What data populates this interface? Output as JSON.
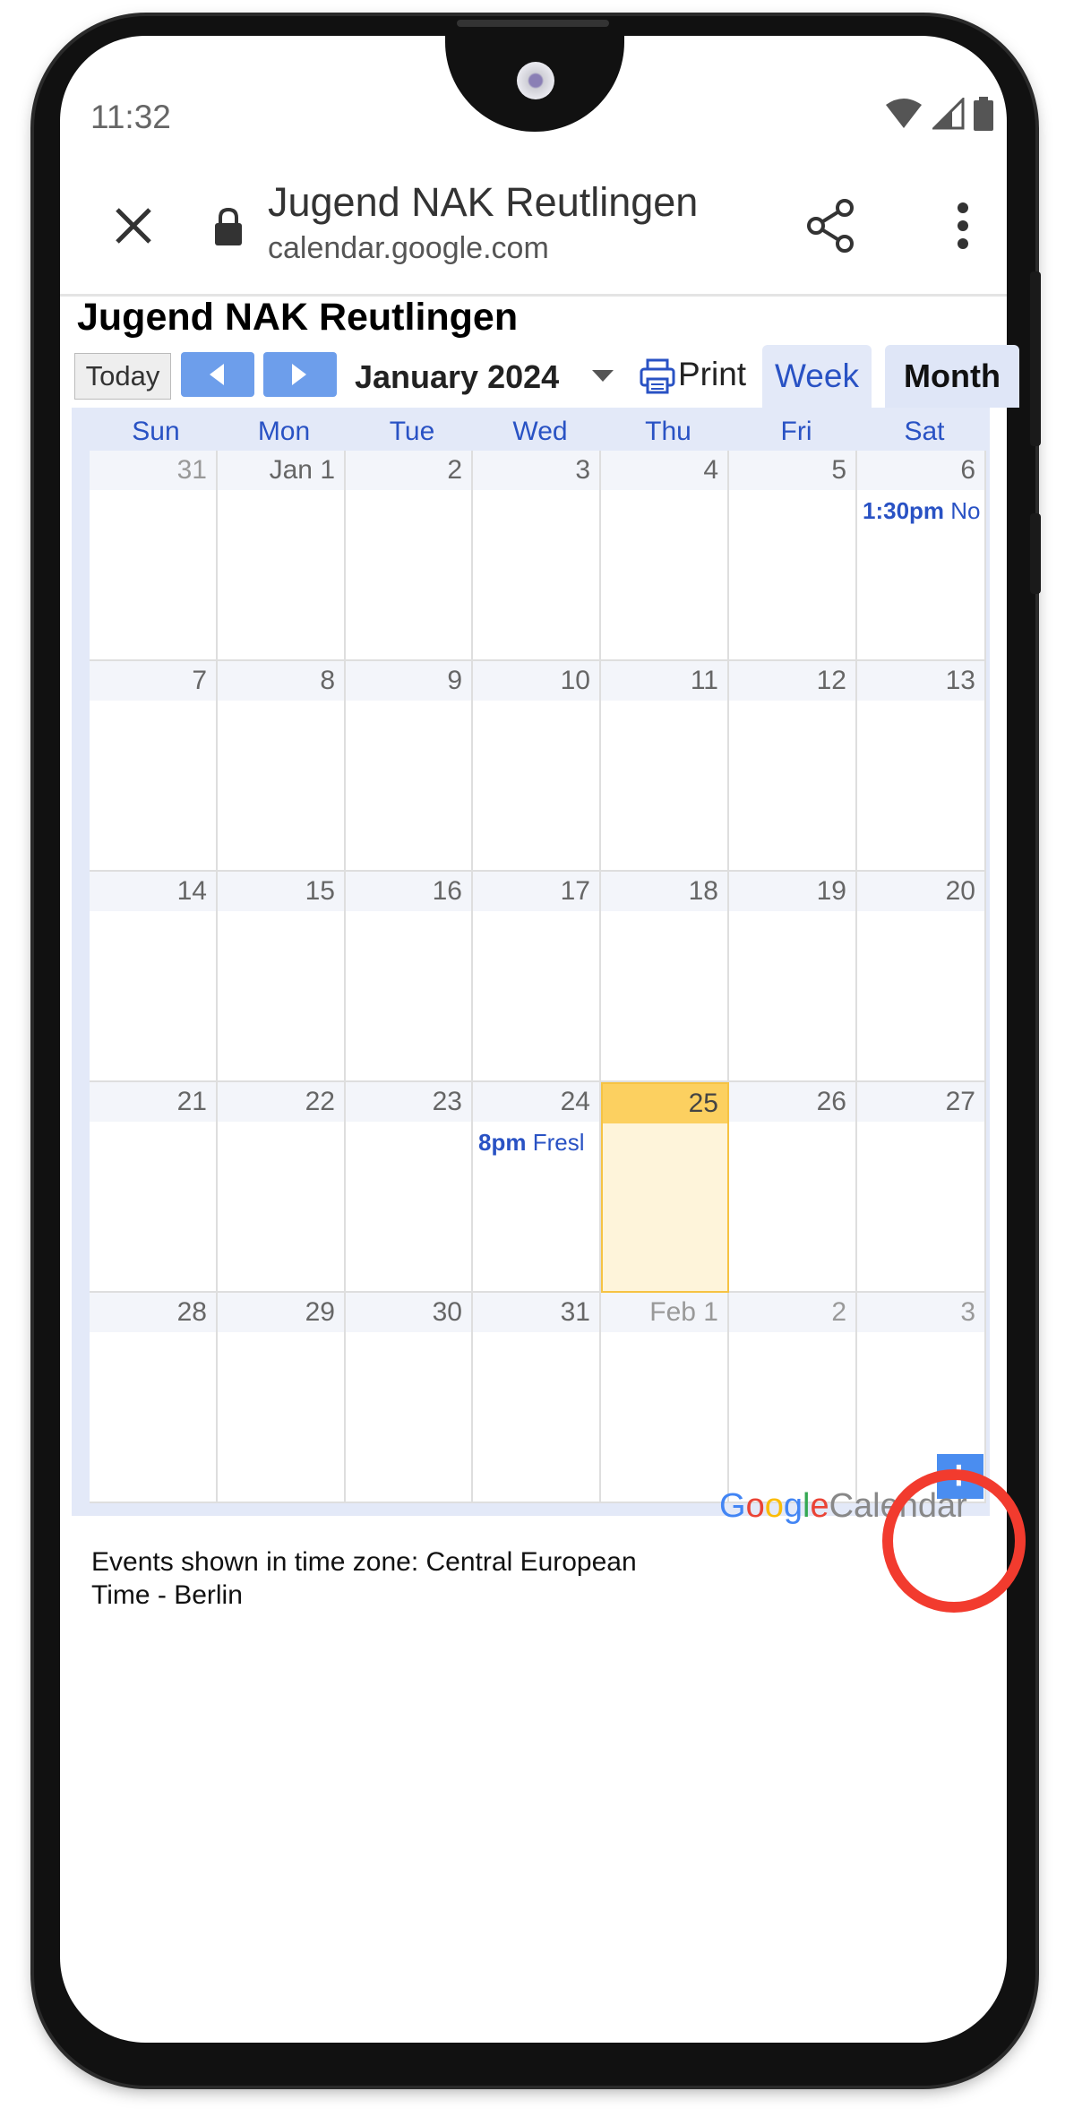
{
  "status": {
    "time": "11:32"
  },
  "tab": {
    "title": "Jugend NAK Reutlingen",
    "url": "calendar.google.com"
  },
  "calendar": {
    "title": "Jugend NAK Reutlingen",
    "today_label": "Today",
    "month_label": "January 2024",
    "print_label": "Print",
    "week_tab": "Week",
    "month_tab": "Month",
    "weekdays": [
      "Sun",
      "Mon",
      "Tue",
      "Wed",
      "Thu",
      "Fri",
      "Sat"
    ],
    "weeks": [
      [
        "31",
        "Jan 1",
        "2",
        "3",
        "4",
        "5",
        "6"
      ],
      [
        "7",
        "8",
        "9",
        "10",
        "11",
        "12",
        "13"
      ],
      [
        "14",
        "15",
        "16",
        "17",
        "18",
        "19",
        "20"
      ],
      [
        "21",
        "22",
        "23",
        "24",
        "25",
        "26",
        "27"
      ],
      [
        "28",
        "29",
        "30",
        "31",
        "Feb 1",
        "2",
        "3"
      ]
    ],
    "events": [
      {
        "time": "1:30pm",
        "title": "No"
      },
      {
        "time": "8pm",
        "title": "Fresl"
      }
    ],
    "timezone_note": "Events shown in time zone: Central European Time - Berlin",
    "brand": {
      "google": "Google",
      "calendar": "Calendar"
    }
  }
}
